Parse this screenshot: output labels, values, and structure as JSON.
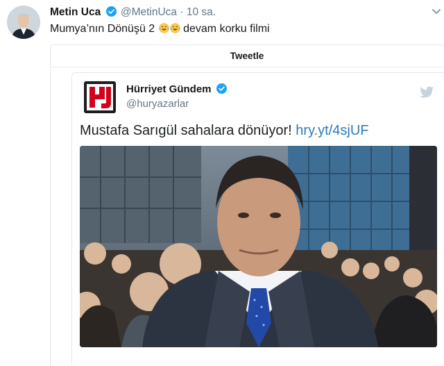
{
  "tweet": {
    "author_name": "Metin Uca",
    "author_handle": "@MetinUca",
    "separator": "·",
    "time": "10 sa.",
    "text_before": "Mumya’nın Dönüşü 2",
    "emojis": [
      "face-with-tears-of-joy",
      "face-with-tears-of-joy"
    ],
    "text_after": "devam korku filmi"
  },
  "quote_card": {
    "header": "Tweetle"
  },
  "embedded_tweet": {
    "name": "Hürriyet Gündem",
    "handle": "@huryazarlar",
    "text": "Mustafa Sarıgül sahalara dönüyor!",
    "link": "hry.yt/4sjUF"
  },
  "icons": {
    "verified": "verified-badge-icon",
    "caret": "chevron-down-icon",
    "bird": "twitter-bird-icon",
    "logo": "hurriyet-logo-icon"
  },
  "colors": {
    "verified": "#1da1f2",
    "link": "#2b7bb9",
    "secondary_text": "#657786",
    "logo_red": "#d0021b"
  }
}
